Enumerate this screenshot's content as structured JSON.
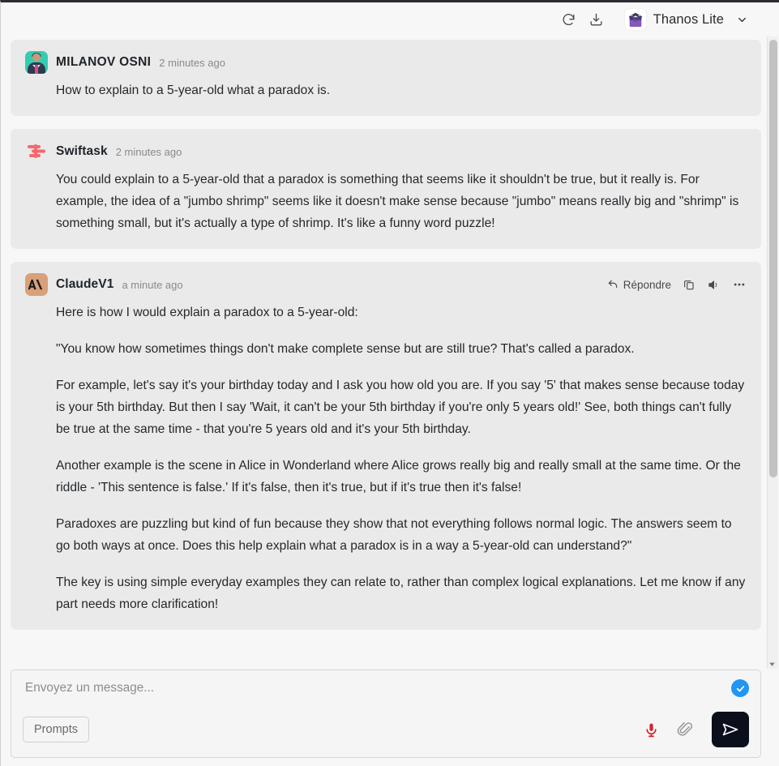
{
  "topbar": {
    "refresh_icon": "refresh-icon",
    "download_icon": "download-icon",
    "model_name": "Thanos Lite",
    "model_avatar_icon": "thanos-avatar-icon",
    "chevron_icon": "chevron-down-icon"
  },
  "messages": [
    {
      "sender": "MILANOV OSNI",
      "timestamp": "2 minutes ago",
      "avatar_icon": "user-photo-avatar",
      "has_actions": false,
      "paragraphs": [
        "How to explain to a 5-year-old what a paradox is."
      ]
    },
    {
      "sender": "Swiftask",
      "timestamp": "2 minutes ago",
      "avatar_icon": "swiftask-logo-icon",
      "has_actions": false,
      "paragraphs": [
        "You could explain to a 5-year-old that a paradox is something that seems like it shouldn't be true, but it really is. For example, the idea of a \"jumbo shrimp\" seems like it doesn't make sense because \"jumbo\" means really big and \"shrimp\" is something small, but it's actually a type of shrimp. It's like a funny word puzzle!"
      ]
    },
    {
      "sender": "ClaudeV1",
      "timestamp": "a minute ago",
      "avatar_icon": "claude-logo-icon",
      "has_actions": true,
      "paragraphs": [
        "Here is how I would explain a paradox to a 5-year-old:",
        "\"You know how sometimes things don't make complete sense but are still true? That's called a paradox.",
        "For example, let's say it's your birthday today and I ask you how old you are. If you say '5' that makes sense because today is your 5th birthday. But then I say 'Wait, it can't be your 5th birthday if you're only 5 years old!' See, both things can't fully be true at the same time - that you're 5 years old and it's your 5th birthday.",
        "Another example is the scene in Alice in Wonderland where Alice grows really big and really small at the same time. Or the riddle - 'This sentence is false.' If it's false, then it's true, but if it's true then it's false!",
        "Paradoxes are puzzling but kind of fun because they show that not everything follows normal logic. The answers seem to go both ways at once. Does this help explain what a paradox is in a way a 5-year-old can understand?\"",
        "The key is using simple everyday examples they can relate to, rather than complex logical explanations. Let me know if any part needs more clarification!"
      ]
    }
  ],
  "message_actions": {
    "reply_label": "Répondre",
    "reply_icon": "reply-arrow-icon",
    "copy_icon": "copy-icon",
    "speaker_icon": "speaker-icon",
    "more_icon": "more-horizontal-icon"
  },
  "composer": {
    "placeholder": "Envoyez un message...",
    "value": "",
    "check_icon": "check-badge-icon",
    "prompts_label": "Prompts",
    "mic_icon": "microphone-icon",
    "attach_icon": "paperclip-icon",
    "send_icon": "send-paper-plane-icon"
  },
  "colors": {
    "page_bg": "#f7f7f7",
    "bubble_bg": "#eaeaea",
    "accent_blue": "#2196f3",
    "swiftask_red": "#f4696e",
    "claude_tan": "#d9a07a",
    "send_dark": "#0b0f1c",
    "mic_red": "#d3232b"
  }
}
